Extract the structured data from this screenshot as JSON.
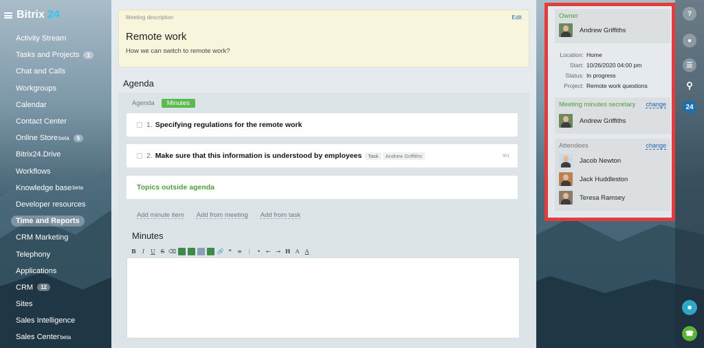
{
  "app": {
    "name": "Bitrix",
    "name_suffix": "24"
  },
  "sidebar": {
    "items": [
      {
        "label": "Activity Stream"
      },
      {
        "label": "Tasks and Projects",
        "count": "1"
      },
      {
        "label": "Chat and Calls"
      },
      {
        "label": "Workgroups"
      },
      {
        "label": "Calendar"
      },
      {
        "label": "Contact Center"
      },
      {
        "label": "Online Store",
        "sup": "beta",
        "count": "5"
      },
      {
        "label": "Bitrix24.Drive"
      },
      {
        "label": "Workflows"
      },
      {
        "label": "Knowledge base",
        "sup": "beta"
      },
      {
        "label": "Developer resources"
      },
      {
        "label": "Time and Reports",
        "active": true
      },
      {
        "label": "CRM Marketing"
      },
      {
        "label": "Telephony"
      },
      {
        "label": "Applications"
      },
      {
        "label": "CRM",
        "count": "12"
      },
      {
        "label": "Sites"
      },
      {
        "label": "Sales Intelligence"
      },
      {
        "label": "Sales Center",
        "sup": "beta"
      }
    ]
  },
  "meeting": {
    "caption": "Meeting description",
    "edit": "Edit",
    "title": "Remote work",
    "description": "How we can switch to remote work?"
  },
  "agenda": {
    "heading": "Agenda",
    "tab_agenda": "Agenda",
    "tab_minutes": "Minutes",
    "items": [
      {
        "num": "1.",
        "title": "Specifying regulations for the remote work"
      },
      {
        "num": "2.",
        "title": "Make sure that this information is understood by employees",
        "tag": "Task",
        "assignee": "Andrew Griffiths",
        "comments": "1"
      }
    ],
    "topics_outside": "Topics outside agenda",
    "links": [
      "Add minute item",
      "Add from meeting",
      "Add from task"
    ]
  },
  "minutes": {
    "heading": "Minutes",
    "toolbar": [
      "B",
      "I",
      "U",
      "S",
      "H",
      "A",
      "A"
    ]
  },
  "info": {
    "owner_label": "Owner",
    "owner": "Andrew Griffiths",
    "location_key": "Location:",
    "location": "Home",
    "start_key": "Start:",
    "start": "10/26/2020 04:00 pm",
    "status_key": "Status:",
    "status": "In progress",
    "project_key": "Project:",
    "project": "Remote work questions",
    "secretary_label": "Meeting minutes secretary",
    "secretary": "Andrew Griffiths",
    "change": "change",
    "attendees_label": "Attendees",
    "attendees": [
      "Jacob Newton",
      "Jack Huddleston",
      "Teresa Ramsey"
    ]
  },
  "rightbar": {
    "badge": "24"
  },
  "colors": {
    "accent_green": "#5cb94e",
    "highlight_red": "#e33c3c",
    "link_blue": "#2067b0"
  }
}
